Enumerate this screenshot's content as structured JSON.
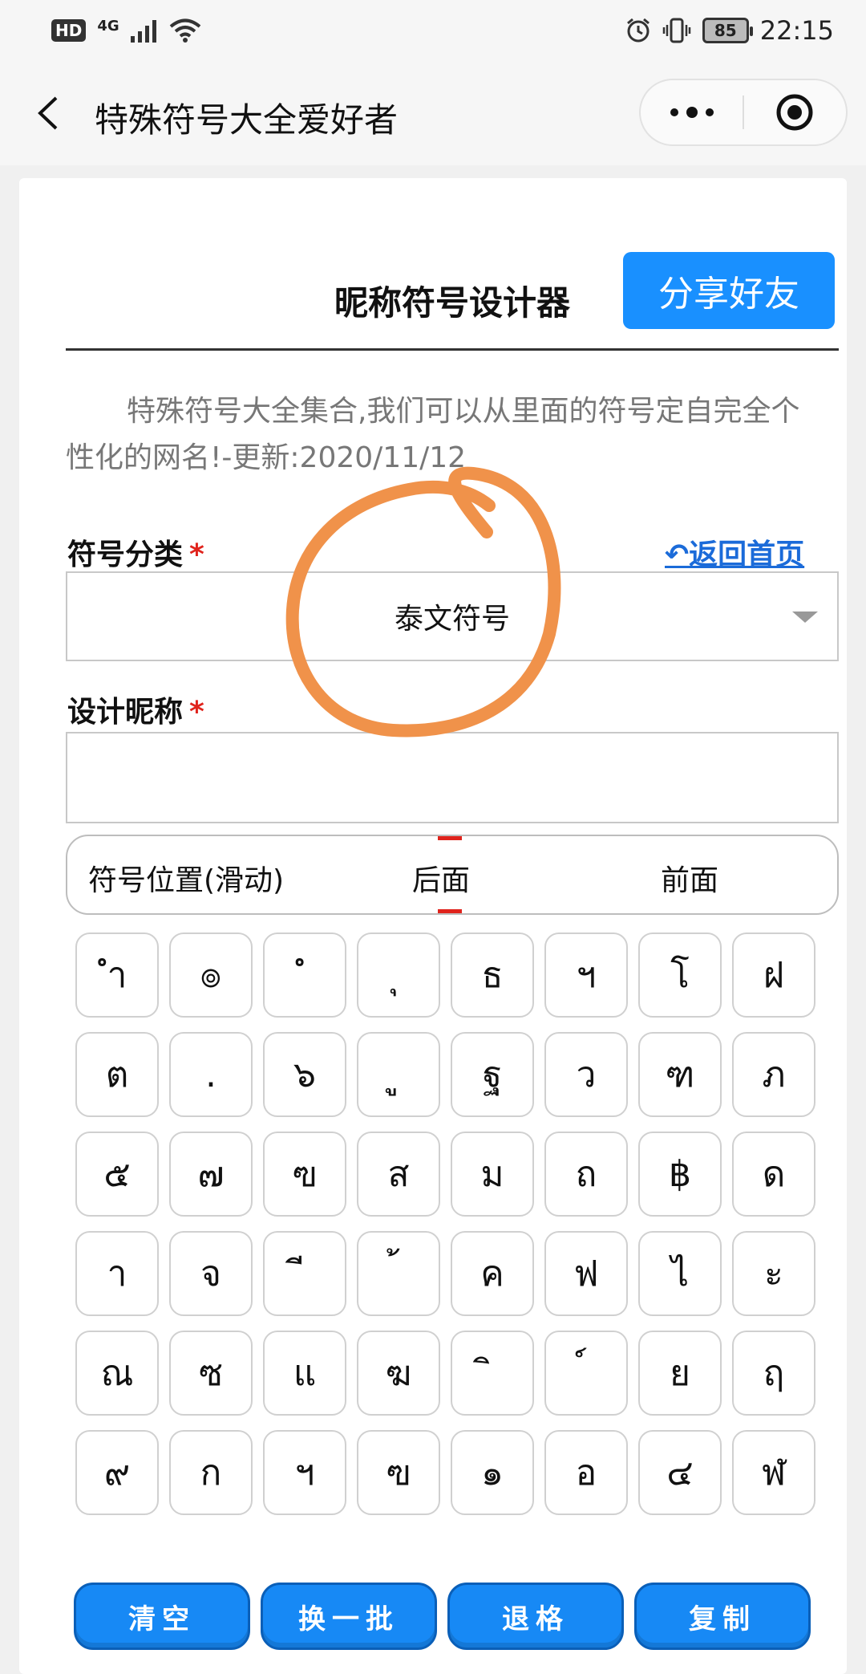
{
  "status_bar": {
    "hd": "HD",
    "network": "4G",
    "battery": "85",
    "time": "22:15",
    "icons": [
      "signal-icon",
      "wifi-icon",
      "alarm-icon",
      "vibrate-icon",
      "battery-icon"
    ]
  },
  "title_bar": {
    "title": "特殊符号大全爱好者",
    "icons": [
      "back-icon",
      "more-icon",
      "target-icon"
    ]
  },
  "card": {
    "title": "昵称符号设计器",
    "share_label": "分享好友",
    "description": "特殊符号大全集合,我们可以从里面的符号定自完全个性化的网名!-更新:2020/11/12"
  },
  "form": {
    "category_label": "符号分类",
    "nickname_label": "设计昵称",
    "required_mark": "*",
    "home_link": "↶返回首页",
    "category_value": "泰文符号",
    "nickname_value": "",
    "position_label": "符号位置(滑动)",
    "position_options": [
      "后面",
      "前面"
    ]
  },
  "symbols": [
    "ำ",
    "๏",
    "ํ",
    "ุ",
    "ธ",
    "ฯ",
    "โ",
    "ฝ",
    "ต",
    ".",
    "๖",
    "ู",
    "ฐ",
    "ว",
    "ฑ",
    "ภ",
    "๕",
    "๗",
    "ฃ",
    "ส",
    "ม",
    "ถ",
    "฿",
    "ด",
    "า",
    "จ",
    "ี",
    "้",
    "ค",
    "ฟ",
    "ไ",
    "ะ",
    "ณ",
    "ซ",
    "แ",
    "ฆ",
    "ิ",
    "์",
    "ย",
    "ฤ",
    "๙",
    "ก",
    "ฯ",
    "ฃ",
    "๑",
    "อ",
    "๔",
    "ฬ"
  ],
  "actions": {
    "clear": "清空",
    "refresh": "换一批",
    "backspace": "退格",
    "copy": "复制"
  },
  "colors": {
    "accent": "#1990ff",
    "required": "#e0231c",
    "link": "#1b6bd9",
    "annotation": "#f0924a"
  }
}
